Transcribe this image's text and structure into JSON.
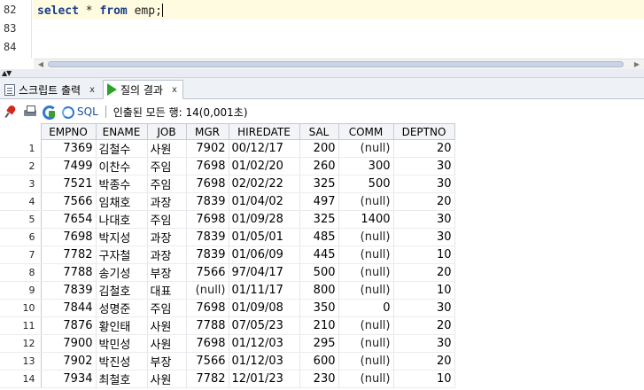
{
  "editor": {
    "line_numbers": [
      "82",
      "83",
      "84"
    ],
    "code": {
      "keyword1": "select",
      "star": " * ",
      "keyword2": "from",
      "table": " emp;"
    }
  },
  "tabs": [
    {
      "label": "스크립트 출력",
      "close": "x"
    },
    {
      "label": "질의 결과",
      "close": "x"
    }
  ],
  "toolbar": {
    "sql_label": "SQL",
    "status_text": "인출된 모든 행: 14(0,001초)"
  },
  "grid": {
    "columns": [
      "EMPNO",
      "ENAME",
      "JOB",
      "MGR",
      "HIREDATE",
      "SAL",
      "COMM",
      "DEPTNO"
    ],
    "rows": [
      [
        "1",
        "7369",
        "김철수",
        "사원",
        "7902",
        "00/12/17",
        "200",
        "(null)",
        "20"
      ],
      [
        "2",
        "7499",
        "이찬수",
        "주임",
        "7698",
        "01/02/20",
        "260",
        "300",
        "30"
      ],
      [
        "3",
        "7521",
        "박종수",
        "주임",
        "7698",
        "02/02/22",
        "325",
        "500",
        "30"
      ],
      [
        "4",
        "7566",
        "임채호",
        "과장",
        "7839",
        "01/04/02",
        "497",
        "(null)",
        "20"
      ],
      [
        "5",
        "7654",
        "나대호",
        "주임",
        "7698",
        "01/09/28",
        "325",
        "1400",
        "30"
      ],
      [
        "6",
        "7698",
        "박지성",
        "과장",
        "7839",
        "01/05/01",
        "485",
        "(null)",
        "30"
      ],
      [
        "7",
        "7782",
        "구자철",
        "과장",
        "7839",
        "01/06/09",
        "445",
        "(null)",
        "10"
      ],
      [
        "8",
        "7788",
        "송기성",
        "부장",
        "7566",
        "97/04/17",
        "500",
        "(null)",
        "20"
      ],
      [
        "9",
        "7839",
        "김철호",
        "대표",
        "(null)",
        "01/11/17",
        "800",
        "(null)",
        "10"
      ],
      [
        "10",
        "7844",
        "성명준",
        "주임",
        "7698",
        "01/09/08",
        "350",
        "0",
        "30"
      ],
      [
        "11",
        "7876",
        "황인태",
        "사원",
        "7788",
        "07/05/23",
        "210",
        "(null)",
        "20"
      ],
      [
        "12",
        "7900",
        "박민성",
        "사원",
        "7698",
        "01/12/03",
        "295",
        "(null)",
        "30"
      ],
      [
        "13",
        "7902",
        "박진성",
        "부장",
        "7566",
        "01/12/03",
        "600",
        "(null)",
        "20"
      ],
      [
        "14",
        "7934",
        "최철호",
        "사원",
        "7782",
        "12/01/23",
        "230",
        "(null)",
        "10"
      ]
    ]
  }
}
